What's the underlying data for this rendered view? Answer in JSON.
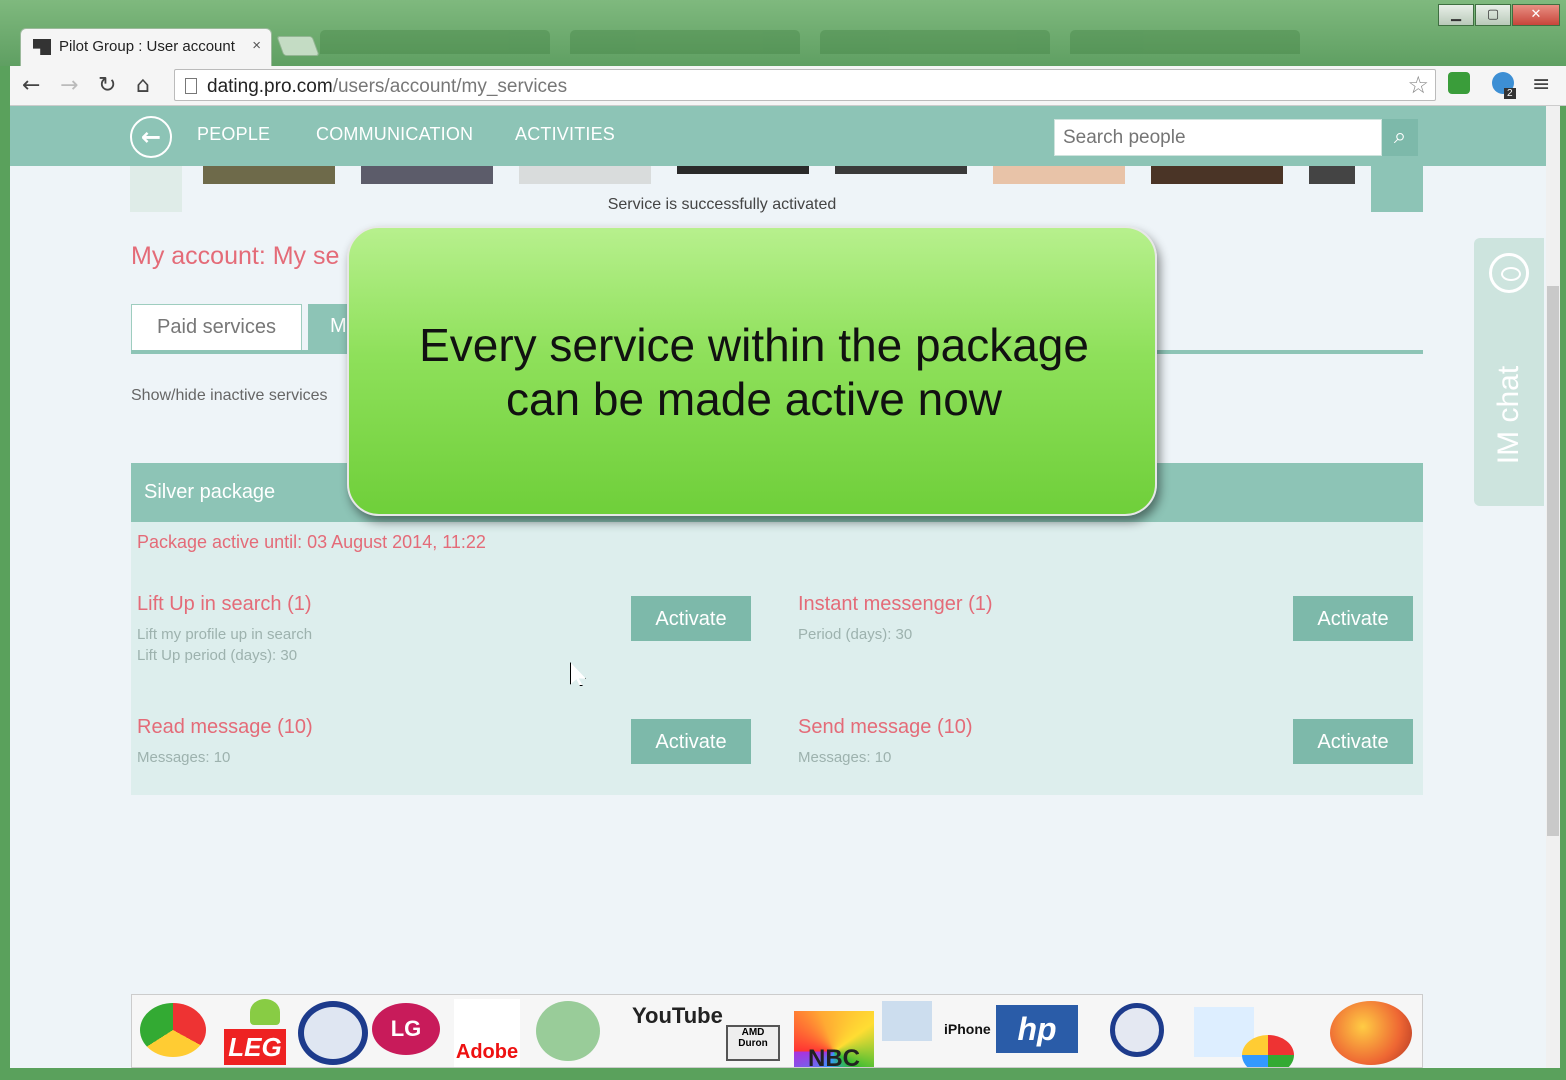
{
  "browser": {
    "tab_title": "Pilot Group : User account",
    "tab_close": "×",
    "url_host": "dating.pro.com",
    "url_path": "/users/account/my_services",
    "window_controls": {
      "minimize": "▁",
      "maximize": "▢",
      "close": "✕"
    },
    "extension_badge": "2"
  },
  "site_nav": {
    "items": [
      {
        "label": "PEOPLE"
      },
      {
        "label": "COMMUNICATION"
      },
      {
        "label": "ACTIVITIES"
      }
    ],
    "search_placeholder": "Search people"
  },
  "notice": "Service is successfully activated",
  "page_title": "My account: My se",
  "tabs": {
    "paid": "Paid services",
    "my": "M"
  },
  "show_hide_link": "Show/hide inactive services",
  "package": {
    "title": "Silver package",
    "active_until": "Package active until: 03 August 2014, 11:22",
    "services": [
      {
        "name": "Lift Up in search (1)",
        "desc": [
          "Lift my profile up in search",
          "Lift Up period (days): 30"
        ],
        "button": "Activate"
      },
      {
        "name": "Instant messenger (1)",
        "desc": [
          "Period (days): 30"
        ],
        "button": "Activate"
      },
      {
        "name": "Read message (10)",
        "desc": [
          "Messages: 10"
        ],
        "button": "Activate"
      },
      {
        "name": "Send message (10)",
        "desc": [
          "Messages: 10"
        ],
        "button": "Activate"
      }
    ]
  },
  "im_chat": "IM chat",
  "callout": {
    "line1": "Every service within the package",
    "line2": "can be made active now"
  },
  "logos": [
    "YouTube",
    "LG",
    "LEG",
    "Adobe",
    "hp",
    "iPhone",
    "AMD Duron",
    "NBC"
  ],
  "colors": {
    "accent": "#8dc4b6",
    "button": "#7db9aa",
    "pink_text": "#e46b78",
    "callout_green": "#8ee05a"
  }
}
